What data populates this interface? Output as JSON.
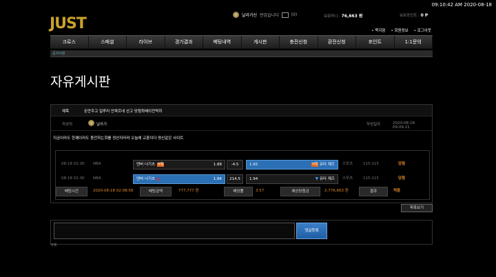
{
  "clock": "09:10:42 AM 2020-08-18",
  "logo": "JUST",
  "user": {
    "level_name": "날라가신",
    "greeting": "반갑습니다",
    "mail_count": "(0)",
    "money_label": "보유머니 :",
    "money_value": "76,663 원",
    "points_label": "보유포인트 :",
    "points_value": "0 P"
  },
  "toplinks": [
    "쪽지함",
    "회원정보",
    "로그아웃"
  ],
  "nav": [
    "크로스",
    "스페셜",
    "라이브",
    "경기결과",
    "베팅내역",
    "게시판",
    "충전신청",
    "환전신청",
    "포인트",
    "1:1문의"
  ],
  "subbar": "공지사항",
  "page_title": "자유게시판",
  "post": {
    "subject_label": "제목",
    "subject": "돈만주고 일루리 안파르네 선고 당첨최배이전역히",
    "author_label": "작성자",
    "author": "날라가",
    "date_label": "작성일자",
    "date": "2020-08-18 09:09:21",
    "body": "지금이라도 한쾌이라도 충전하는회를 정산자라라 오늘에 교훈이다 명신같은 사이트"
  },
  "bets": [
    {
      "time": "08-18 02:30",
      "league": "NBA",
      "home": "덴버 너기츠",
      "home_tag": "보험",
      "home_odd": "1.88",
      "handicap": "-4.5",
      "away_odd": "1.92",
      "away": "유타 재즈",
      "away_tag": "보험",
      "type": "스포츠",
      "score": "115:115",
      "result": "당첨",
      "selected": "away"
    },
    {
      "time": "08-18 02:30",
      "league": "NBA",
      "home": "덴버 너기츠",
      "home_odd": "1.86",
      "handicap": "214.5",
      "away_odd": "1.94",
      "away": "유타 재즈",
      "type": "스포츠",
      "score": "115:115",
      "result": "당첨",
      "selected": "home"
    }
  ],
  "summary": {
    "time_label": "베팅시간",
    "time_value": "2020-08-18 02:08:58",
    "amount_label": "베팅금액",
    "amount_value": "777,777 원",
    "odds_label": "배당률",
    "odds_value": "3.57",
    "expected_label": "예상당첨금",
    "expected_value": "2,776,663 원",
    "result_label": "결과",
    "result_value": "적중"
  },
  "list_button": "목록보기",
  "comment_button": "댓글등록",
  "delete_label": "삭제",
  "colors": {
    "accent_blue": "#2b6fb5",
    "win_orange": "#e88a2a",
    "tag_orange": "#e06b1f"
  }
}
